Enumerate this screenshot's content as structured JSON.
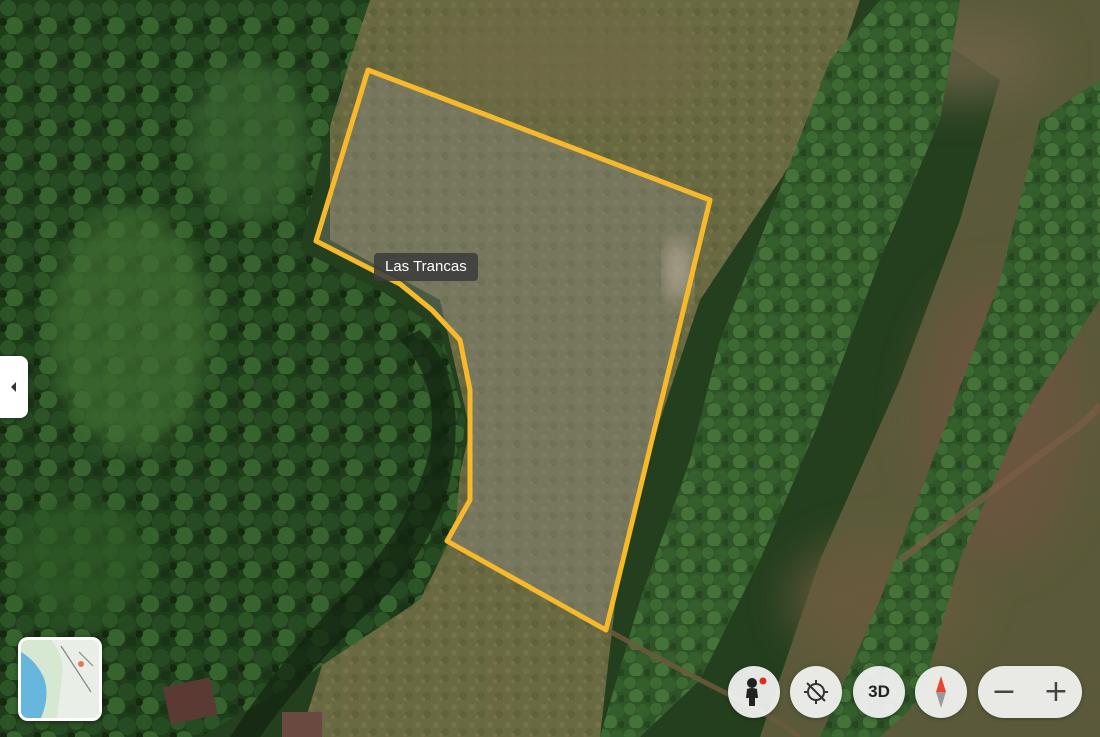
{
  "map": {
    "parcel": {
      "label": "Las Trancas",
      "outline_color": "#F6B92B",
      "fill_color": "#8F8F8F"
    }
  },
  "controls": {
    "side_panel_toggle_icon": "chevron-left-icon",
    "minimap_icon": "map-thumbnail",
    "street_view_icon": "pegman-icon",
    "location_icon": "location-off-icon",
    "view_3d_label": "3D",
    "compass_icon": "compass-icon",
    "zoom_out_label": "−",
    "zoom_in_label": "+"
  }
}
